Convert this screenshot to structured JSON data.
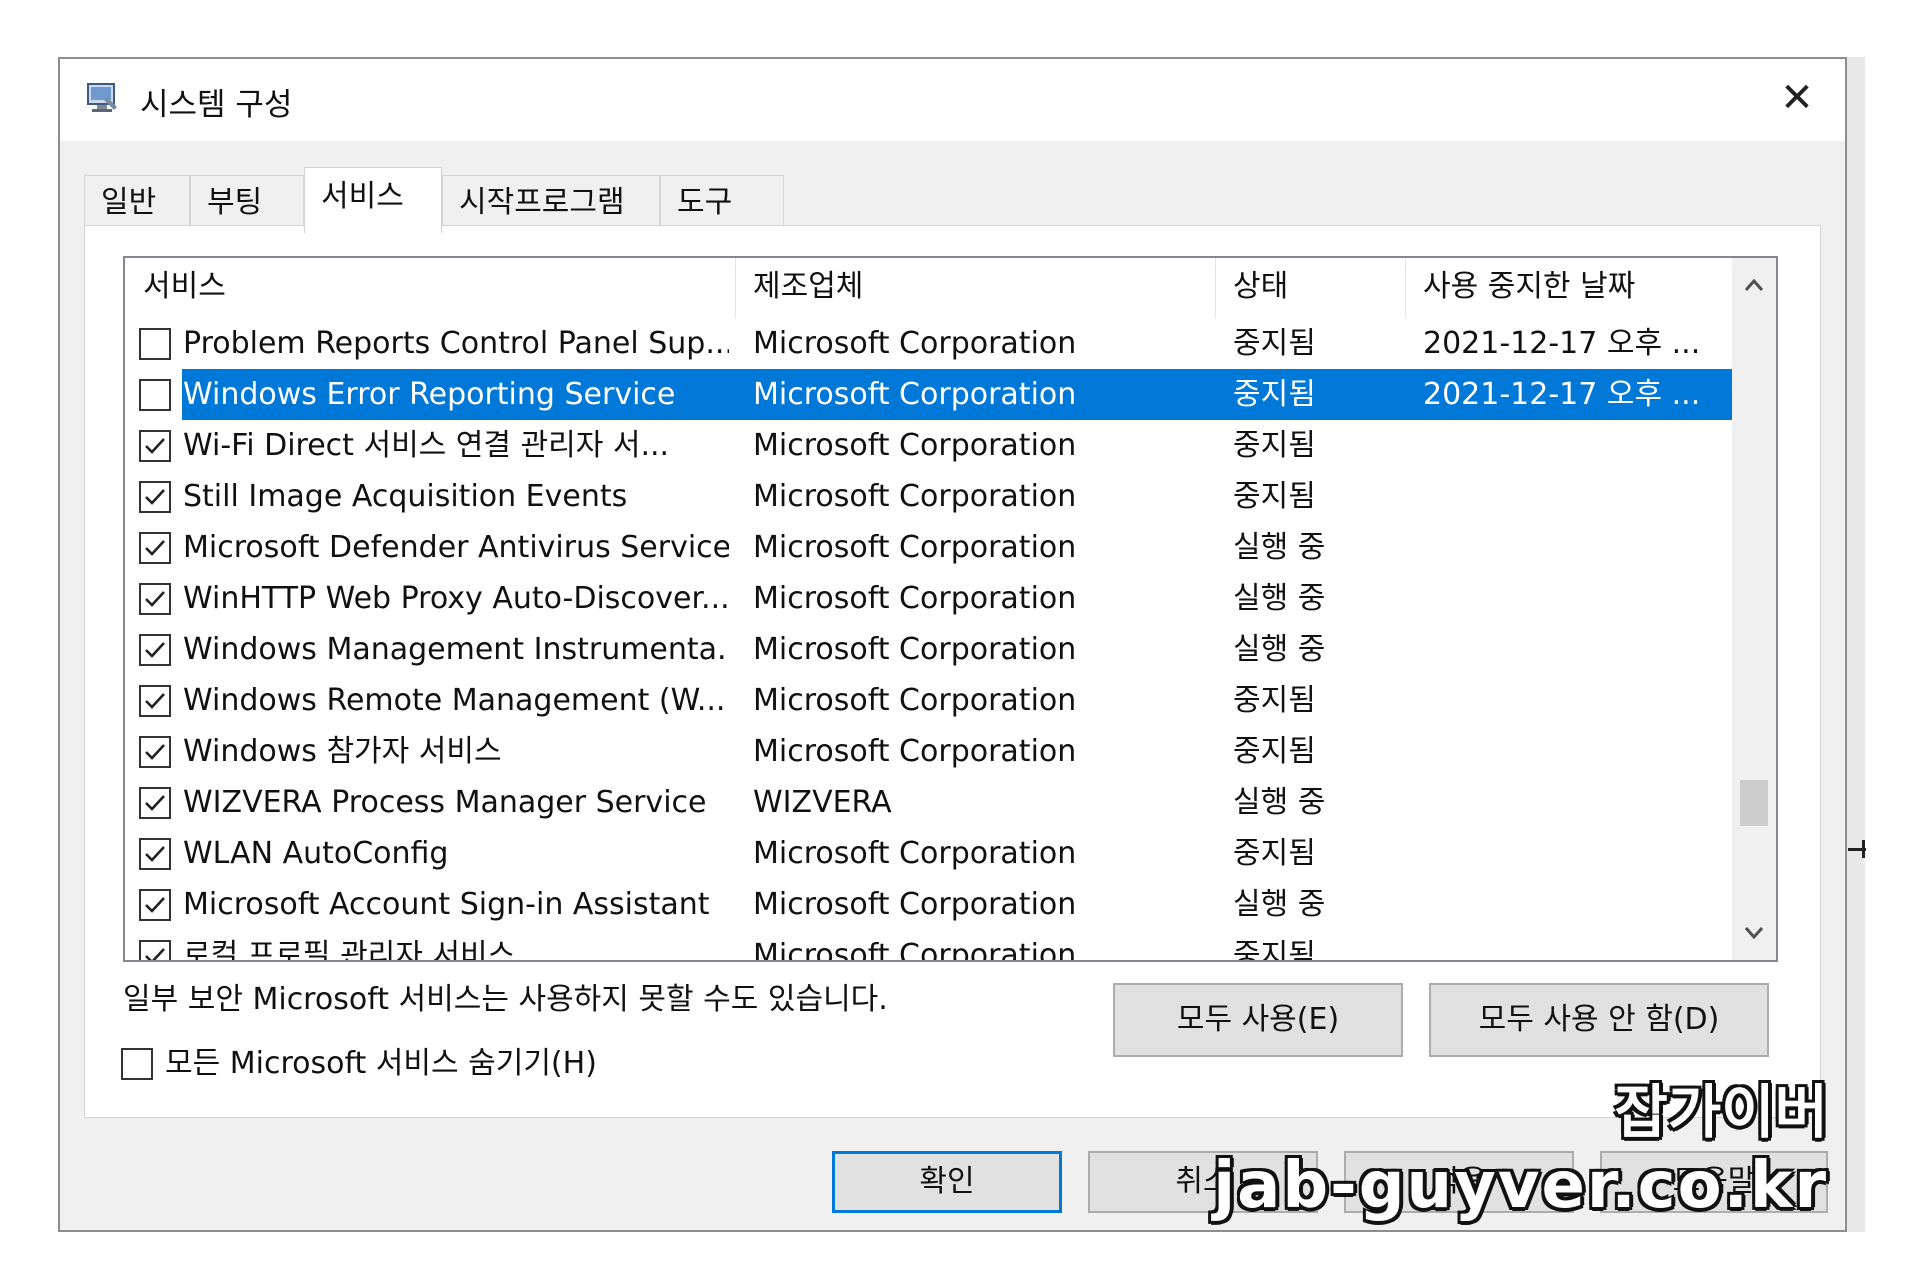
{
  "window": {
    "title": "시스템 구성",
    "close_glyph": "✕"
  },
  "tabs": [
    {
      "label": "일반",
      "active": false
    },
    {
      "label": "부팅",
      "active": false
    },
    {
      "label": "서비스",
      "active": true
    },
    {
      "label": "시작프로그램",
      "active": false
    },
    {
      "label": "도구",
      "active": false
    }
  ],
  "services": {
    "columns": [
      "서비스",
      "제조업체",
      "상태",
      "사용 중지한 날짜"
    ],
    "rows": [
      {
        "checked": false,
        "name": "Problem Reports Control Panel Sup...",
        "vendor": "Microsoft Corporation",
        "status": "중지됨",
        "date": "2021-12-17 오후 ...",
        "selected": false
      },
      {
        "checked": false,
        "name": "Windows Error Reporting Service",
        "vendor": "Microsoft Corporation",
        "status": "중지됨",
        "date": "2021-12-17 오후 ...",
        "selected": true
      },
      {
        "checked": true,
        "name": "Wi-Fi Direct 서비스 연결 관리자 서...",
        "vendor": "Microsoft Corporation",
        "status": "중지됨",
        "date": "",
        "selected": false
      },
      {
        "checked": true,
        "name": "Still Image Acquisition Events",
        "vendor": "Microsoft Corporation",
        "status": "중지됨",
        "date": "",
        "selected": false
      },
      {
        "checked": true,
        "name": "Microsoft Defender Antivirus Service",
        "vendor": "Microsoft Corporation",
        "status": "실행 중",
        "date": "",
        "selected": false
      },
      {
        "checked": true,
        "name": "WinHTTP Web Proxy Auto-Discover...",
        "vendor": "Microsoft Corporation",
        "status": "실행 중",
        "date": "",
        "selected": false
      },
      {
        "checked": true,
        "name": "Windows Management Instrumenta...",
        "vendor": "Microsoft Corporation",
        "status": "실행 중",
        "date": "",
        "selected": false
      },
      {
        "checked": true,
        "name": "Windows Remote Management (W...",
        "vendor": "Microsoft Corporation",
        "status": "중지됨",
        "date": "",
        "selected": false
      },
      {
        "checked": true,
        "name": "Windows 참가자 서비스",
        "vendor": "Microsoft Corporation",
        "status": "중지됨",
        "date": "",
        "selected": false
      },
      {
        "checked": true,
        "name": "WIZVERA Process Manager Service",
        "vendor": "WIZVERA",
        "status": "실행 중",
        "date": "",
        "selected": false
      },
      {
        "checked": true,
        "name": "WLAN AutoConfig",
        "vendor": "Microsoft Corporation",
        "status": "중지됨",
        "date": "",
        "selected": false
      },
      {
        "checked": true,
        "name": "Microsoft Account Sign-in Assistant",
        "vendor": "Microsoft Corporation",
        "status": "실행 중",
        "date": "",
        "selected": false
      },
      {
        "checked": true,
        "name": "로컬 프로필 관리자 서비스",
        "vendor": "Microsoft Corporation",
        "status": "중지됨",
        "date": "",
        "selected": false
      }
    ],
    "scroll_up_glyph": "^",
    "scroll_down_glyph": "v"
  },
  "note": "일부 보안 Microsoft 서비스는 사용하지 못할 수도 있습니다.",
  "buttons": {
    "enable_all": "모두 사용(E)",
    "disable_all": "모두 사용 안 함(D)",
    "ok": "확인",
    "cancel": "취소",
    "apply": "적용",
    "help": "도움말"
  },
  "hide_ms": {
    "label": "모든 Microsoft 서비스 숨기기(H)",
    "checked": false
  },
  "watermark": {
    "korean": "잡가이버",
    "url": "jab-guyver.co.kr"
  }
}
